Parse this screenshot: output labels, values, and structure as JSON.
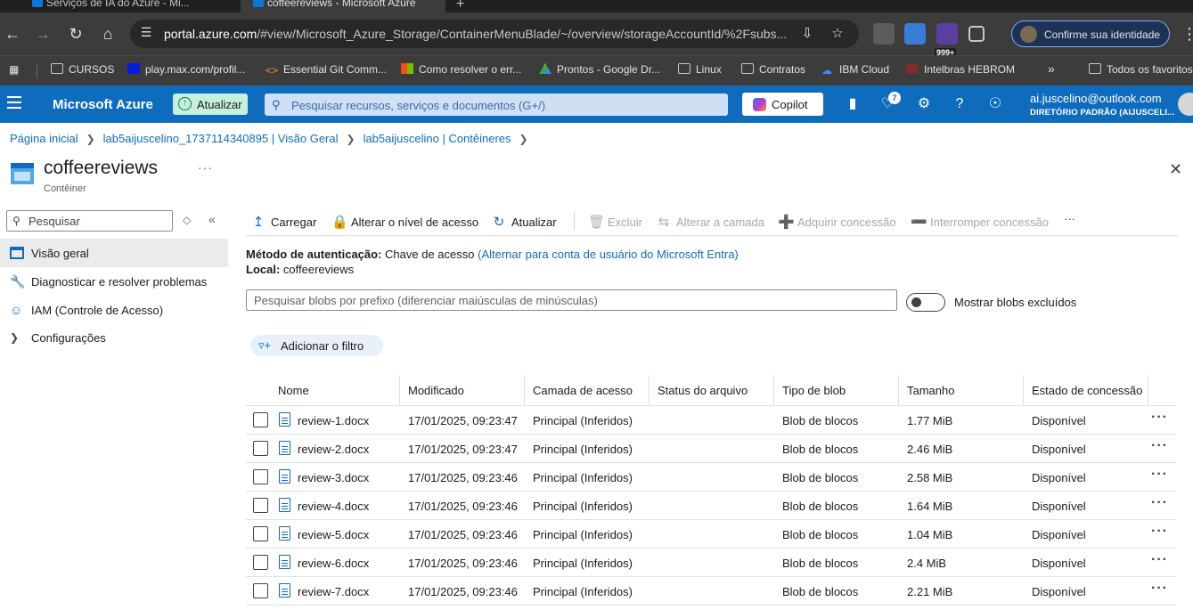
{
  "browser": {
    "tabs": [
      {
        "title": "Serviços de IA do Azure - Mi..."
      },
      {
        "title": "coffeereviews - Microsoft Azure"
      }
    ],
    "url_host": "portal.azure.com",
    "url_rest": "/#view/Microsoft_Azure_Storage/ContainerMenuBlade/~/overview/storageAccountId/%2Fsubs...",
    "extension_badge": "999+",
    "identity_label": "Confirme sua identidade",
    "bookmarks": [
      {
        "label": "CURSOS"
      },
      {
        "label": "play.max.com/profil..."
      },
      {
        "label": "Essential Git Comm..."
      },
      {
        "label": "Como resolver o err..."
      },
      {
        "label": "Prontos - Google Dr..."
      },
      {
        "label": "Linux"
      },
      {
        "label": "Contratos"
      },
      {
        "label": "IBM Cloud"
      },
      {
        "label": "Intelbras HEBROM"
      },
      {
        "label": "Todos os favoritos"
      }
    ],
    "bookmarks_overflow": "»"
  },
  "azure": {
    "brand": "Microsoft Azure",
    "upgrade_label": "Atualizar",
    "search_placeholder": "Pesquisar recursos, serviços e documentos (G+/)",
    "copilot_label": "Copilot",
    "notification_count": "7",
    "account_email": "ai.juscelino@outlook.com",
    "account_directory": "DIRETÓRIO PADRÃO (AIJUSCELI...",
    "accent_color": "#0f6cbd"
  },
  "breadcrumb": [
    {
      "label": "Página inicial"
    },
    {
      "label": "lab5aijuscelino_1737114340895 | Visão Geral"
    },
    {
      "label": "lab5aijuscelino | Contêineres"
    }
  ],
  "page": {
    "title": "coffeereviews",
    "subtitle": "Contêiner",
    "more": "···"
  },
  "nav": {
    "search_placeholder": "Pesquisar",
    "items": [
      {
        "label": "Visão geral",
        "icon": "overview-icon",
        "active": true
      },
      {
        "label": "Diagnosticar e resolver problemas",
        "icon": "wrench-icon"
      },
      {
        "label": "IAM (Controle de Acesso)",
        "icon": "people-icon"
      },
      {
        "label": "Configurações",
        "icon": "chevron-right-icon"
      }
    ]
  },
  "commands": {
    "upload": "Carregar",
    "change_access": "Alterar o nível de acesso",
    "refresh": "Atualizar",
    "delete": "Excluir",
    "change_tier": "Alterar a camada",
    "acquire_lease": "Adquirir concessão",
    "break_lease": "Interromper concessão",
    "more": "···"
  },
  "info": {
    "auth_label": "Método de autenticação:",
    "auth_value": "Chave de acesso",
    "auth_link": "(Alternar para conta de usuário do Microsoft Entra)",
    "location_label": "Local:",
    "location_value": "coffeereviews"
  },
  "blob_search_placeholder": "Pesquisar blobs por prefixo (diferenciar maiúsculas de minúsculas)",
  "show_deleted_label": "Mostrar blobs excluídos",
  "add_filter_label": "Adicionar o filtro",
  "table": {
    "columns": [
      "Nome",
      "Modificado",
      "Camada de acesso",
      "Status do arquivo",
      "Tipo de blob",
      "Tamanho",
      "Estado de concessão"
    ],
    "rows": [
      {
        "name": "review-1.docx",
        "modified": "17/01/2025, 09:23:47",
        "tier": "Principal (Inferidos)",
        "archive": "",
        "type": "Blob de blocos",
        "size": "1.77 MiB",
        "lease": "Disponível"
      },
      {
        "name": "review-2.docx",
        "modified": "17/01/2025, 09:23:47",
        "tier": "Principal (Inferidos)",
        "archive": "",
        "type": "Blob de blocos",
        "size": "2.46 MiB",
        "lease": "Disponível"
      },
      {
        "name": "review-3.docx",
        "modified": "17/01/2025, 09:23:46",
        "tier": "Principal (Inferidos)",
        "archive": "",
        "type": "Blob de blocos",
        "size": "2.58 MiB",
        "lease": "Disponível"
      },
      {
        "name": "review-4.docx",
        "modified": "17/01/2025, 09:23:46",
        "tier": "Principal (Inferidos)",
        "archive": "",
        "type": "Blob de blocos",
        "size": "1.64 MiB",
        "lease": "Disponível"
      },
      {
        "name": "review-5.docx",
        "modified": "17/01/2025, 09:23:46",
        "tier": "Principal (Inferidos)",
        "archive": "",
        "type": "Blob de blocos",
        "size": "1.04 MiB",
        "lease": "Disponível"
      },
      {
        "name": "review-6.docx",
        "modified": "17/01/2025, 09:23:46",
        "tier": "Principal (Inferidos)",
        "archive": "",
        "type": "Blob de blocos",
        "size": "2.4 MiB",
        "lease": "Disponível"
      },
      {
        "name": "review-7.docx",
        "modified": "17/01/2025, 09:23:46",
        "tier": "Principal (Inferidos)",
        "archive": "",
        "type": "Blob de blocos",
        "size": "2.21 MiB",
        "lease": "Disponível"
      }
    ],
    "row_more": "···"
  }
}
